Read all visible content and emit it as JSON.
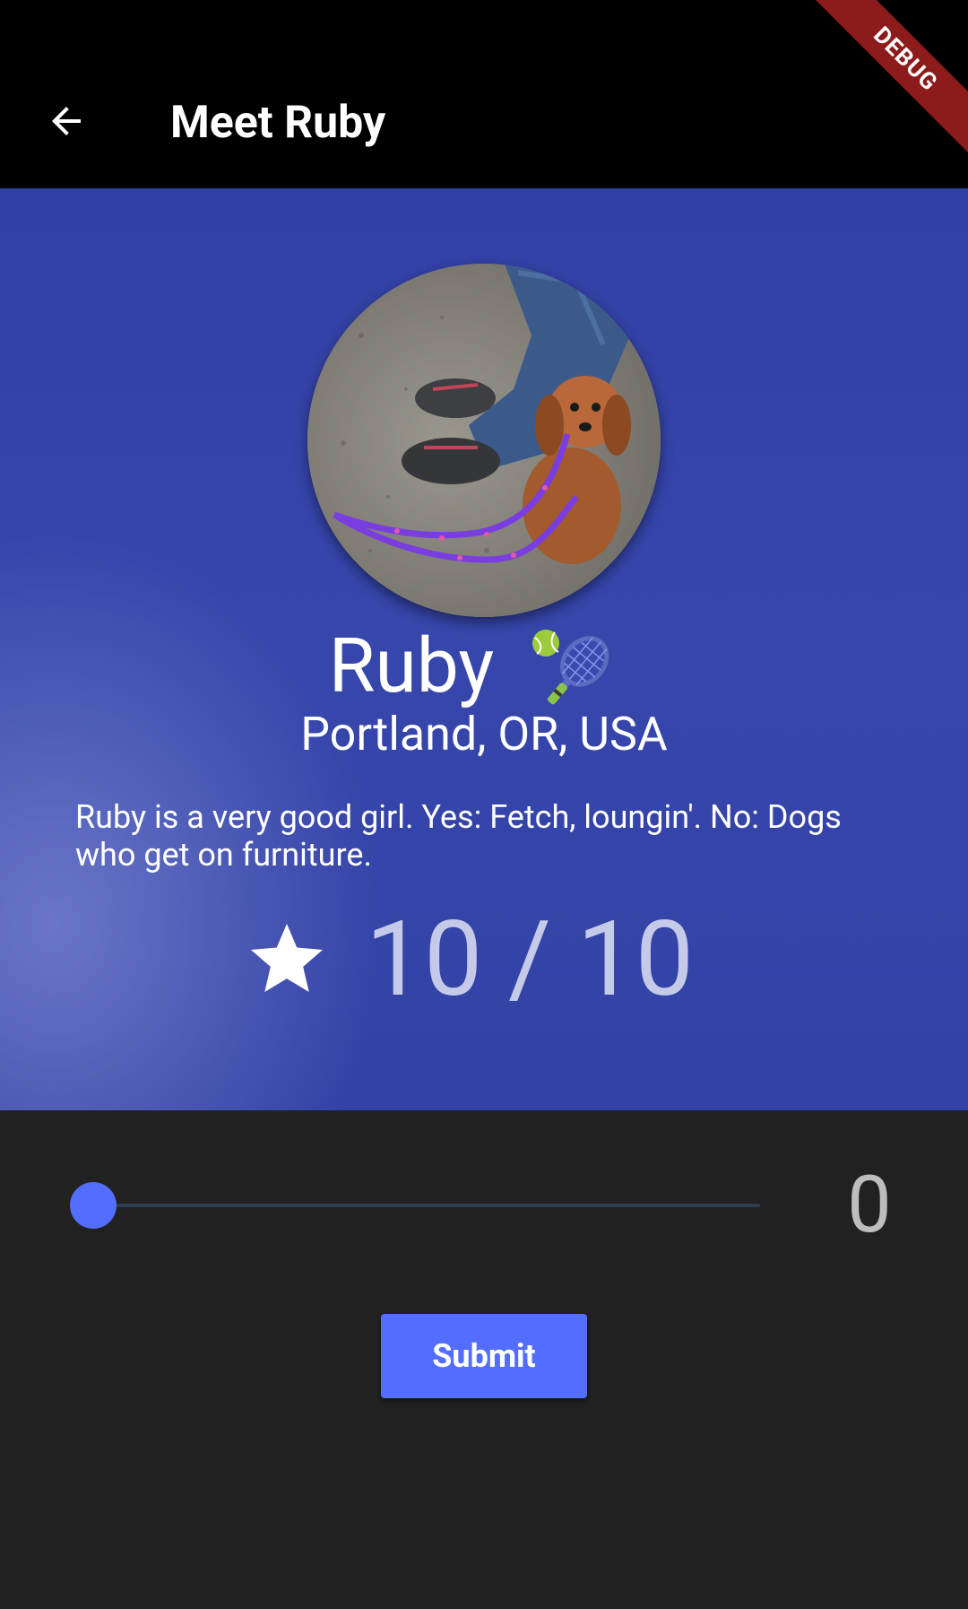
{
  "app_bar": {
    "title": "Meet Ruby",
    "back_icon": "arrow-back-icon"
  },
  "debug_banner": {
    "label": "DEBUG",
    "color": "#8e1b1b"
  },
  "profile": {
    "name": "Ruby",
    "name_icon": "tennis-racket-icon",
    "location": "Portland, OR, USA",
    "bio": "Ruby is a very good girl. Yes: Fetch, loungin'. No: Dogs who get on furniture.",
    "rating_icon": "star-icon",
    "rating": "10 / 10",
    "avatar_icon": "dog-photo-avatar"
  },
  "rating_input": {
    "value": 0,
    "value_label": "0",
    "min": 0,
    "max": 10
  },
  "actions": {
    "submit_label": "Submit"
  },
  "colors": {
    "accent": "#536dfe",
    "hero_background": "#3646ab",
    "app_bar": "#000000",
    "body_background": "#212121"
  }
}
